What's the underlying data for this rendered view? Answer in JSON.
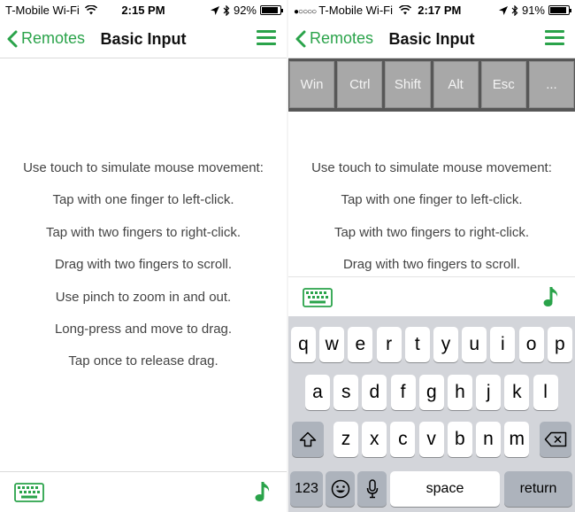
{
  "left": {
    "status": {
      "carrier": "T-Mobile Wi-Fi",
      "time": "2:15 PM",
      "battery": "92%",
      "battery_level": 0.92
    },
    "nav": {
      "back_label": "Remotes",
      "title": "Basic Input"
    },
    "instructions": [
      "Use touch to simulate mouse movement:",
      "Tap with one finger to left-click.",
      "Tap with two fingers to right-click.",
      "Drag with two fingers to scroll.",
      "Use pinch to zoom in and out.",
      "Long-press and move to drag.",
      "Tap once to release drag."
    ]
  },
  "right": {
    "status": {
      "carrier": "T-Mobile Wi-Fi",
      "time": "2:17 PM",
      "battery": "91%",
      "battery_level": 0.91
    },
    "nav": {
      "back_label": "Remotes",
      "title": "Basic Input"
    },
    "modifier_keys": [
      "Win",
      "Ctrl",
      "Shift",
      "Alt",
      "Esc",
      "..."
    ],
    "instructions": [
      "Use touch to simulate mouse movement:",
      "Tap with one finger to left-click.",
      "Tap with two fingers to right-click.",
      "Drag with two fingers to scroll."
    ],
    "keyboard": {
      "row1": [
        "q",
        "w",
        "e",
        "r",
        "t",
        "y",
        "u",
        "i",
        "o",
        "p"
      ],
      "row2": [
        "a",
        "s",
        "d",
        "f",
        "g",
        "h",
        "j",
        "k",
        "l"
      ],
      "row3": [
        "z",
        "x",
        "c",
        "v",
        "b",
        "n",
        "m"
      ],
      "numbers_label": "123",
      "space_label": "space",
      "return_label": "return"
    }
  },
  "colors": {
    "accent": "#2aa34a",
    "modbar": "#575757",
    "modkey": "#a8a8a8",
    "keyboard_bg": "#d3d5da"
  },
  "icons": [
    "chevron-left-icon",
    "hamburger-menu-icon",
    "keyboard-icon",
    "music-note-icon",
    "wifi-icon",
    "location-arrow-icon",
    "bluetooth-icon",
    "battery-icon",
    "shift-icon",
    "backspace-icon",
    "emoji-icon",
    "microphone-icon"
  ]
}
